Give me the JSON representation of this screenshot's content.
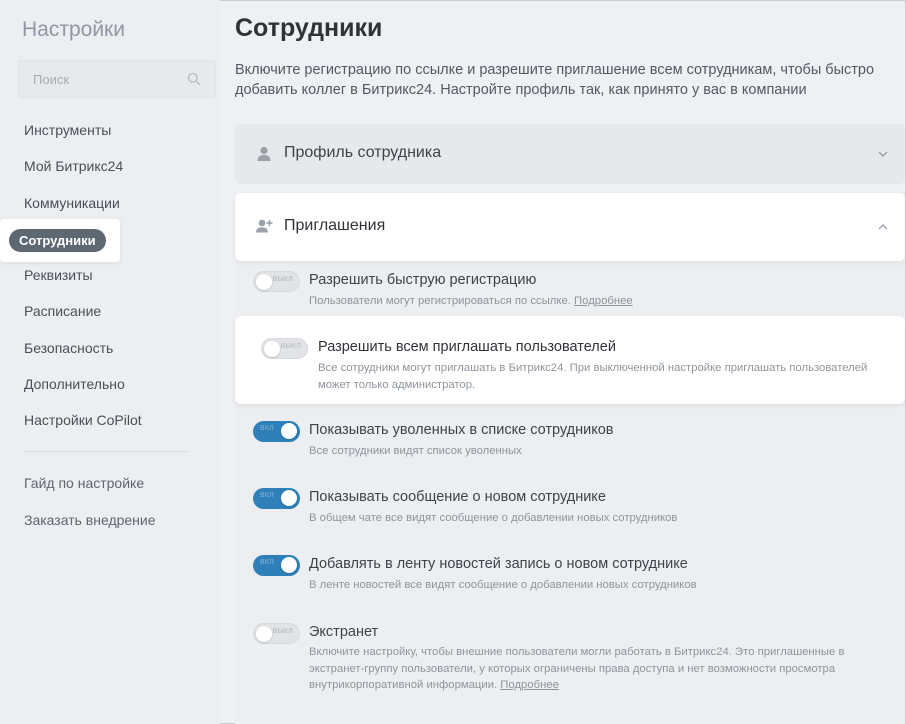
{
  "sidebar": {
    "title": "Настройки",
    "search_placeholder": "Поиск",
    "items": [
      {
        "label": "Инструменты"
      },
      {
        "label": "Мой Битрикс24"
      },
      {
        "label": "Коммуникации"
      },
      {
        "label": "Сотрудники"
      },
      {
        "label": "Реквизиты"
      },
      {
        "label": "Расписание"
      },
      {
        "label": "Безопасность"
      },
      {
        "label": "Дополнительно"
      },
      {
        "label": "Настройки CoPilot"
      }
    ],
    "bottom_items": [
      {
        "label": "Гайд по настройке"
      },
      {
        "label": "Заказать внедрение"
      }
    ],
    "active": "Сотрудники"
  },
  "main": {
    "title": "Сотрудники",
    "description": "Включите регистрацию по ссылке и разрешите приглашение всем сотрудникам, чтобы быстро добавить коллег в Битрикс24. Настройте профиль так, как принято у вас в компании",
    "sections": {
      "profile": {
        "label": "Профиль сотрудника"
      },
      "invites": {
        "label": "Приглашения"
      }
    },
    "settings": [
      {
        "title": "Разрешить быструю регистрацию",
        "desc": "Пользователи могут регистрироваться по ссылке.",
        "more": "Подробнее",
        "state": "off",
        "state_label": "ВЫКЛ"
      },
      {
        "title": "Разрешить всем приглашать пользователей",
        "desc": "Все сотрудники могут приглашать в Битрикс24. При выключенной настройке приглашать пользователей может только администратор.",
        "state": "off",
        "state_label": "ВЫКЛ"
      },
      {
        "title": "Показывать уволенных в списке сотрудников",
        "desc": "Все сотрудники видят список уволенных",
        "state": "on",
        "state_label": "ВКЛ"
      },
      {
        "title": "Показывать сообщение о новом сотруднике",
        "desc": "В общем чате все видят сообщение о добавлении новых сотрудников",
        "state": "on",
        "state_label": "ВКЛ"
      },
      {
        "title": "Добавлять в ленту новостей запись о новом сотруднике",
        "desc": "В ленте новостей все видят сообщение о добавлении новых сотрудников",
        "state": "on",
        "state_label": "ВКЛ"
      },
      {
        "title": "Экстранет",
        "desc": "Включите настройку, чтобы внешние пользователи могли работать в Битрикс24. Это приглашенные в экстранет-группу пользователи, у которых ограничены права доступа и нет возможности просмотра внутрикорпоративной информации.",
        "more": "Подробнее",
        "state": "off",
        "state_label": "ВЫКЛ"
      }
    ]
  },
  "colors": {
    "toggle_on": "#2f80b8",
    "active_pill": "#5e6873",
    "background": "#eef0f3"
  }
}
